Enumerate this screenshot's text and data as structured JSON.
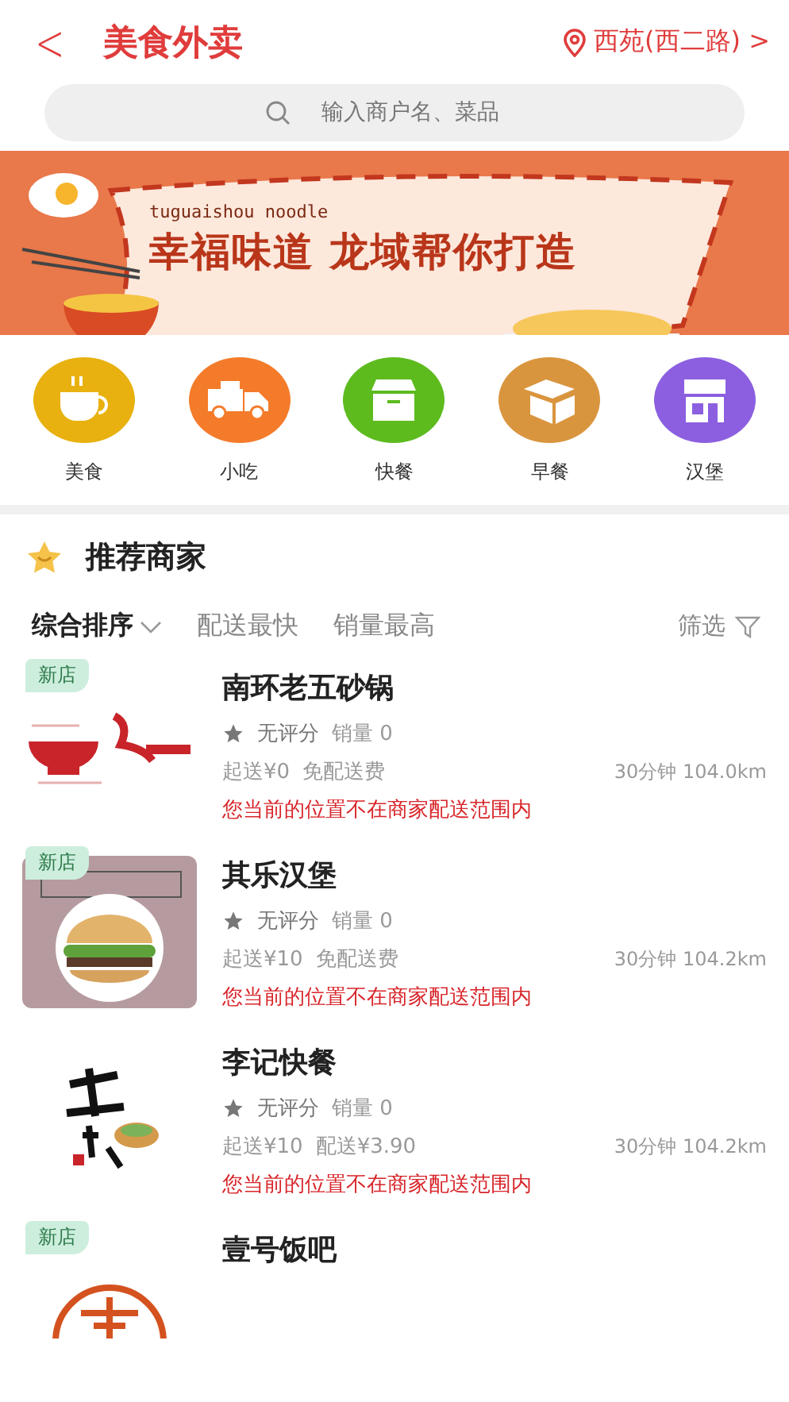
{
  "header": {
    "back": "<",
    "title": "美食外卖",
    "location": "西苑(西二路)",
    "chevron": ">"
  },
  "search": {
    "placeholder": "输入商户名、菜品"
  },
  "banner": {
    "kind": "picture",
    "caption": "tuguaishou noodle",
    "headline": "幸福味道 龙域帮你打造"
  },
  "categories": [
    {
      "label": "美食",
      "kind": "cup",
      "color": "#e8b10f"
    },
    {
      "label": "小吃",
      "kind": "truck",
      "color": "#f47b2a"
    },
    {
      "label": "快餐",
      "kind": "box",
      "color": "#5dbb1e"
    },
    {
      "label": "早餐",
      "kind": "parcel",
      "color": "#d9953e"
    },
    {
      "label": "汉堡",
      "kind": "store",
      "color": "#8c5fe0"
    }
  ],
  "section": {
    "title": "推荐商家"
  },
  "sort_tabs": [
    {
      "label": "综合排序",
      "selected": true,
      "dropdown": true
    },
    {
      "label": "配送最快",
      "selected": false,
      "dropdown": false
    },
    {
      "label": "销量最高",
      "selected": false,
      "dropdown": false
    }
  ],
  "filter": {
    "label": "筛选"
  },
  "merchants": [
    {
      "name": "南环老五砂锅",
      "badge": "新店",
      "rating": "无评分",
      "sales": "销量 0",
      "minimum": "起送¥0",
      "fee": "免配送费",
      "eta": "30分钟 104.0km",
      "warning": "您当前的位置不在商家配送范围内"
    },
    {
      "name": "其乐汉堡",
      "badge": "新店",
      "rating": "无评分",
      "sales": "销量 0",
      "minimum": "起送¥10",
      "fee": "免配送费",
      "eta": "30分钟 104.2km",
      "warning": "您当前的位置不在商家配送范围内"
    },
    {
      "name": "李记快餐",
      "rating": "无评分",
      "sales": "销量 0",
      "minimum": "起送¥10",
      "fee": "配送¥3.90",
      "eta": "30分钟 104.2km",
      "warning": "您当前的位置不在商家配送范围内"
    },
    {
      "name": "壹号饭吧",
      "badge": "新店"
    }
  ]
}
